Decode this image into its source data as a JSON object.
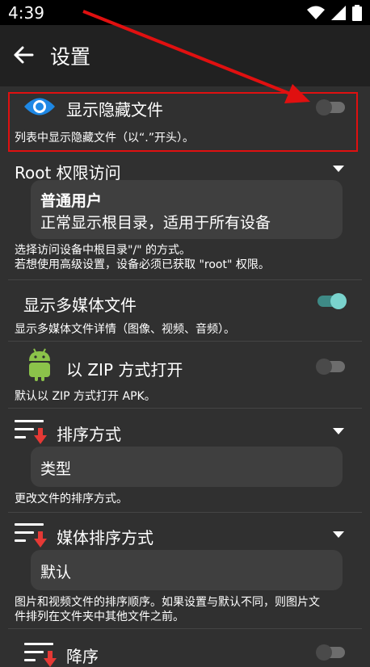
{
  "status_bar": {
    "time": "4:39"
  },
  "app_bar": {
    "title": "设置"
  },
  "settings": {
    "hidden_files": {
      "label": "显示隐藏文件",
      "description": "列表中显示隐藏文件（以“.”开头）。",
      "enabled": false
    },
    "root_access": {
      "label": "Root 权限访问",
      "selected_title": "普通用户",
      "selected_detail": "正常显示根目录，适用于所有设备",
      "description_line1": "选择访问设备中根目录\"/\" 的方式。",
      "description_line2": "若想使用高级设置，设备必须已获取 \"root\" 权限。"
    },
    "media_files": {
      "label": "显示多媒体文件",
      "description": "显示多媒体文件详情（图像、视频、音频）。",
      "enabled": true
    },
    "zip_open": {
      "label": "以 ZIP 方式打开",
      "description": "默认以 ZIP 方式打开 APK。",
      "enabled": false
    },
    "sort_mode": {
      "label": "排序方式",
      "selected": "类型",
      "description": "更改文件的排序方式。"
    },
    "media_sort_mode": {
      "label": "媒体排序方式",
      "selected": "默认",
      "description_line1": "图片和视频文件的排序顺序。如果设置与默认不同，则图片文",
      "description_line2": "件排列在文件夹中其他文件之前。"
    },
    "descending": {
      "label": "降序",
      "enabled": false
    }
  },
  "colors": {
    "background": "#303030",
    "app_bar": "#212121",
    "accent": "#7ad3cd",
    "highlight": "#e01010",
    "eye_blue": "#1e88e5",
    "android_green": "#8bc34a",
    "sort_arrow": "#e53935"
  }
}
